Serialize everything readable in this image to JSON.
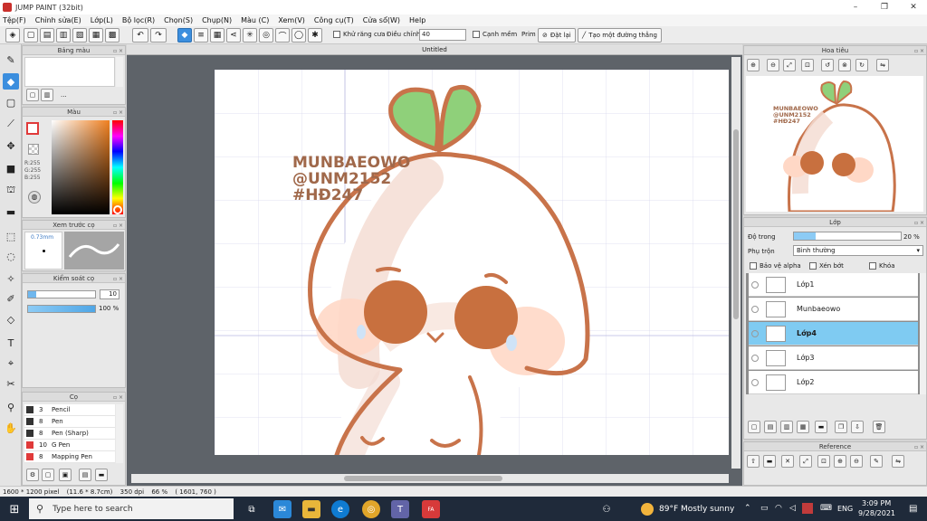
{
  "window": {
    "title": "JUMP PAINT (32bit)",
    "minimize": "–",
    "maximize": "❐",
    "close": "✕"
  },
  "menu": [
    "Tệp(F)",
    "Chỉnh sửa(E)",
    "Lớp(L)",
    "Bộ lọc(R)",
    "Chọn(S)",
    "Chụp(N)",
    "Màu (C)",
    "Xem(V)",
    "Công cụ(T)",
    "Cửa sổ(W)",
    "Help"
  ],
  "toolbar": {
    "antialias_label": "Khử răng cưa",
    "adjust_label": "Điều chỉnh",
    "adjust_value": "40",
    "sharp_label": "Cạnh mềm",
    "prim_label": "Prim",
    "reset_label": "Đặt lại",
    "create_line_label": "Tạo một đường thẳng"
  },
  "panels": {
    "palette_title": "Bảng màu",
    "palette_dots": "...",
    "color_title": "Màu",
    "color_values": {
      "r": "R:255",
      "g": "G:255",
      "b": "B:255"
    },
    "preview_title": "Xem trước cọ",
    "preview_size": "0.73mm",
    "tip_size_title": "Kiểm soát cọ",
    "tip_size_value": "10",
    "tip_opacity_value": "100 %",
    "brush_title": "Cọ",
    "brushes": [
      {
        "size": "3",
        "name": "Pencil",
        "color": "#333333"
      },
      {
        "size": "8",
        "name": "Pen",
        "color": "#333333"
      },
      {
        "size": "8",
        "name": "Pen (Sharp)",
        "color": "#333333"
      },
      {
        "size": "10",
        "name": "G Pen",
        "color": "#e03a3a"
      },
      {
        "size": "8",
        "name": "Mapping Pen",
        "color": "#e03a3a"
      }
    ],
    "navigator_title": "Hoa tiêu",
    "layer_title": "Lớp",
    "opacity_label": "Độ trong",
    "opacity_value": "20 %",
    "opacity_fraction": 0.2,
    "blend_label": "Phụ trộn",
    "blend_value": "Bình thường",
    "protect_alpha": "Bảo vệ alpha",
    "clipping": "Xén bớt",
    "lock": "Khóa",
    "layers": [
      {
        "name": "Lớp1",
        "selected": false
      },
      {
        "name": "Munbaeowo",
        "selected": false
      },
      {
        "name": "Lớp4",
        "selected": true
      },
      {
        "name": "Lớp3",
        "selected": false
      },
      {
        "name": "Lớp2",
        "selected": false
      }
    ],
    "reference_title": "Reference"
  },
  "canvas": {
    "tab_title": "Untitled",
    "watermark_lines": [
      "MUNBAEOWO",
      "@UNM2152",
      "#HĐ247"
    ],
    "nav_watermark_lines": [
      "MUNBAEOWO",
      "@UNM2152",
      "#HĐ247"
    ]
  },
  "status": {
    "size": "1600 * 1200 pixel",
    "physical": "(11.6 * 8.7cm)",
    "dpi": "350 dpi",
    "zoom": "66 %",
    "coords": "( 1601, 760 )"
  },
  "taskbar": {
    "search_placeholder": "Type here to search",
    "weather": "89°F  Mostly sunny",
    "lang": "ENG",
    "time": "3:09 PM",
    "date": "9/28/2021"
  },
  "colors": {
    "accent": "#3b8ede",
    "selected_layer": "#7fcbf2",
    "character_outline": "#c8734a",
    "leaf_green": "#8fd07a",
    "eye_brown": "#c8703f",
    "blush": "#ffd2c0"
  }
}
